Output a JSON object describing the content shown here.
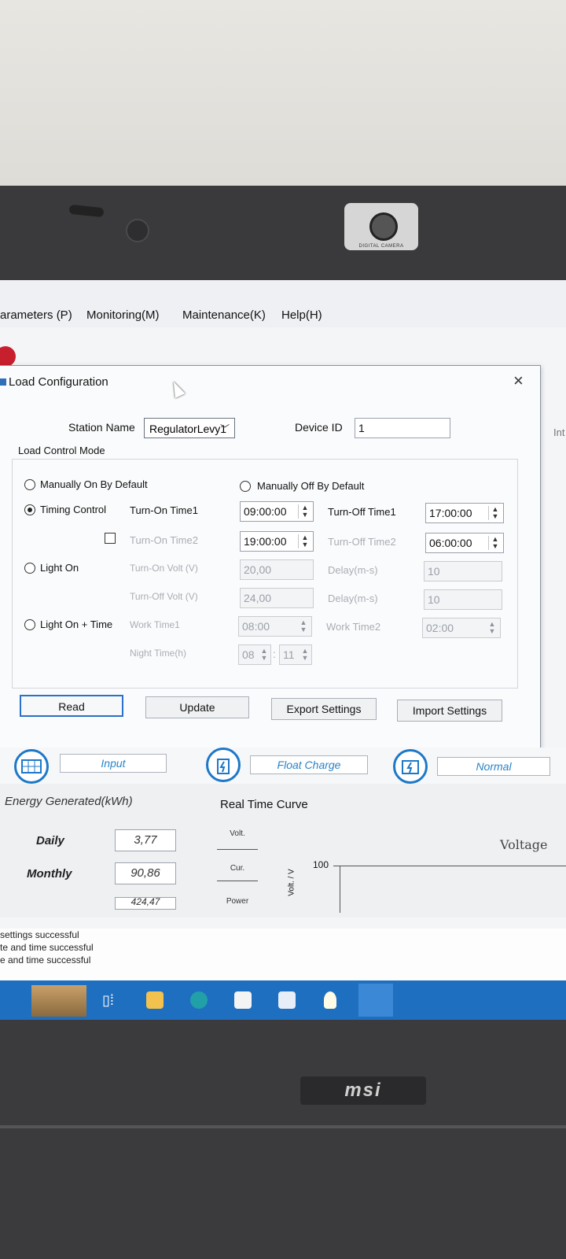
{
  "menu": {
    "items": [
      "arameters (P)",
      "Monitoring(M)",
      "Maintenance(K)",
      "Help(H)"
    ]
  },
  "dialog": {
    "title": "Load Configuration",
    "close": "×",
    "station_label": "Station Name",
    "station_value": "RegulatorLevy1",
    "device_label": "Device ID",
    "device_value": "1",
    "group_label": "Load Control Mode",
    "modes": {
      "manual_on": "Manually On By Default",
      "manual_off": "Manually Off By Default",
      "timing": "Timing Control",
      "light_on": "Light On",
      "light_time": "Light On + Time"
    },
    "timing": {
      "on1_label": "Turn-On Time1",
      "on1_value": "09:00:00",
      "off1_label": "Turn-Off Time1",
      "off1_value": "17:00:00",
      "on2_label": "Turn-On Time2",
      "on2_value": "19:00:00",
      "off2_label": "Turn-Off Time2",
      "off2_value": "06:00:00"
    },
    "light": {
      "on_volt_label": "Turn-On  Volt (V)",
      "on_volt_value": "20,00",
      "delay1_label": "Delay(m-s)",
      "delay1_value": "10",
      "off_volt_label": "Turn-Off Volt (V)",
      "off_volt_value": "24,00",
      "delay2_label": "Delay(m-s)",
      "delay2_value": "10"
    },
    "light_time": {
      "work1_label": "Work Time1",
      "work1_value": "08:00",
      "work2_label": "Work Time2",
      "work2_value": "02:00",
      "night_label": "Night Time(h)",
      "night_h": "08",
      "night_sep": ":",
      "night_m": "11"
    },
    "buttons": {
      "read": "Read",
      "update": "Update",
      "export": "Export Settings",
      "import": "Import Settings"
    }
  },
  "peek": {
    "right_label": "Int"
  },
  "status": {
    "input": "Input",
    "float": "Float Charge",
    "normal": "Normal"
  },
  "energy": {
    "title": "Energy Generated(kWh)",
    "daily_label": "Daily",
    "daily_value": "3,77",
    "monthly_label": "Monthly",
    "monthly_value": "90,86",
    "yearly_partial": "424,47"
  },
  "curve": {
    "title": "Real Time Curve",
    "tab_volt": "Volt.",
    "tab_cur": "Cur.",
    "tab_power": "Power",
    "y_axis": "Volt. / V",
    "y_tick": "100",
    "legend": "Voltage"
  },
  "log": {
    "lines": [
      "settings successful",
      "te and time successful",
      "e and time successful"
    ]
  },
  "camera": {
    "label": "DIGITAL CAMERA"
  },
  "brand": "msi",
  "colors": {
    "accent": "#1d78c8",
    "taskbar": "#1f6fc0",
    "status_text": "#2a83c9"
  }
}
